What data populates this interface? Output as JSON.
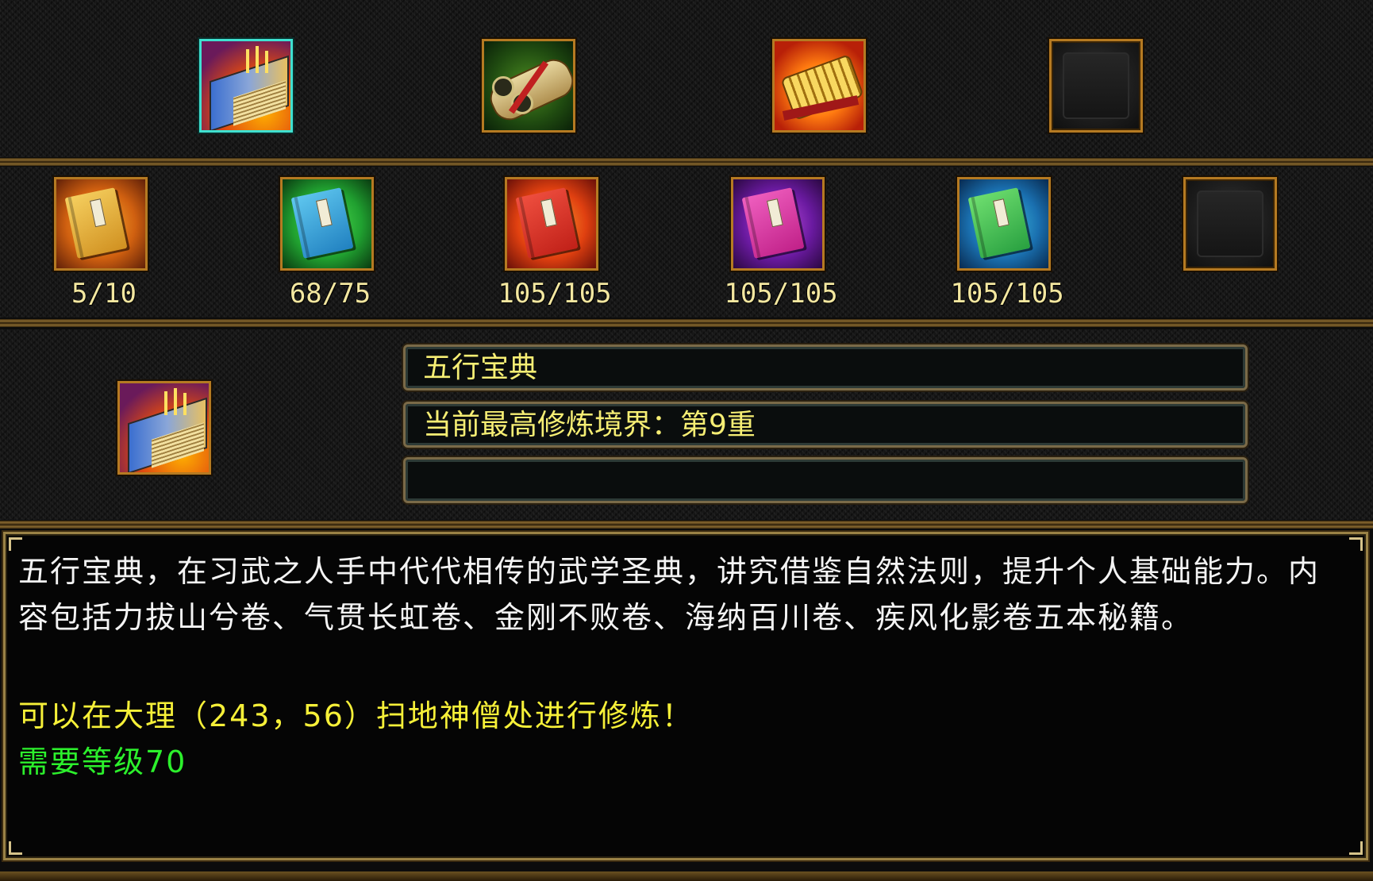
{
  "top_tabs": [
    {
      "id": "wuxing_baodian",
      "icon": "golden-tome-icon",
      "selected": true
    },
    {
      "id": "scroll_bundle",
      "icon": "scroll-bundle-icon",
      "selected": false
    },
    {
      "id": "golden_scrolls",
      "icon": "golden-scroll-icon",
      "selected": false
    },
    {
      "id": "empty",
      "icon": "empty-slot-icon",
      "selected": false
    }
  ],
  "books": [
    {
      "icon": "yellow-book-icon",
      "color": "#e0a23a",
      "progress": "5/10"
    },
    {
      "icon": "blue-book-icon",
      "color": "#2f9fd8",
      "progress": "68/75"
    },
    {
      "icon": "red-book-icon",
      "color": "#e0472a",
      "progress": "105/105"
    },
    {
      "icon": "purple-book-icon",
      "color": "#d0369a",
      "progress": "105/105"
    },
    {
      "icon": "green-book-icon",
      "color": "#3fbf5a",
      "progress": "105/105"
    },
    {
      "icon": "empty-slot-icon",
      "color": "",
      "progress": ""
    }
  ],
  "detail": {
    "icon": "golden-tome-icon",
    "name": "五行宝典",
    "realm": "当前最高修炼境界：第9重",
    "extra": ""
  },
  "description": {
    "text": "五行宝典，在习武之人手中代代相传的武学圣典，讲究借鉴自然法则，提升个人基础能力。内容包括力拔山兮卷、气贯长虹卷、金刚不败卷、海纳百川卷、疾风化影卷五本秘籍。",
    "location": "可以在大理（243，56）扫地神僧处进行修炼！",
    "requirement": "需要等级70"
  },
  "colors": {
    "caption": "#f3e7a0",
    "info_text": "#f6ee74",
    "location_text": "#f6f038",
    "requirement_text": "#2cf02c",
    "frame": "#b57a22",
    "selected_frame": "#3fe0d0"
  }
}
